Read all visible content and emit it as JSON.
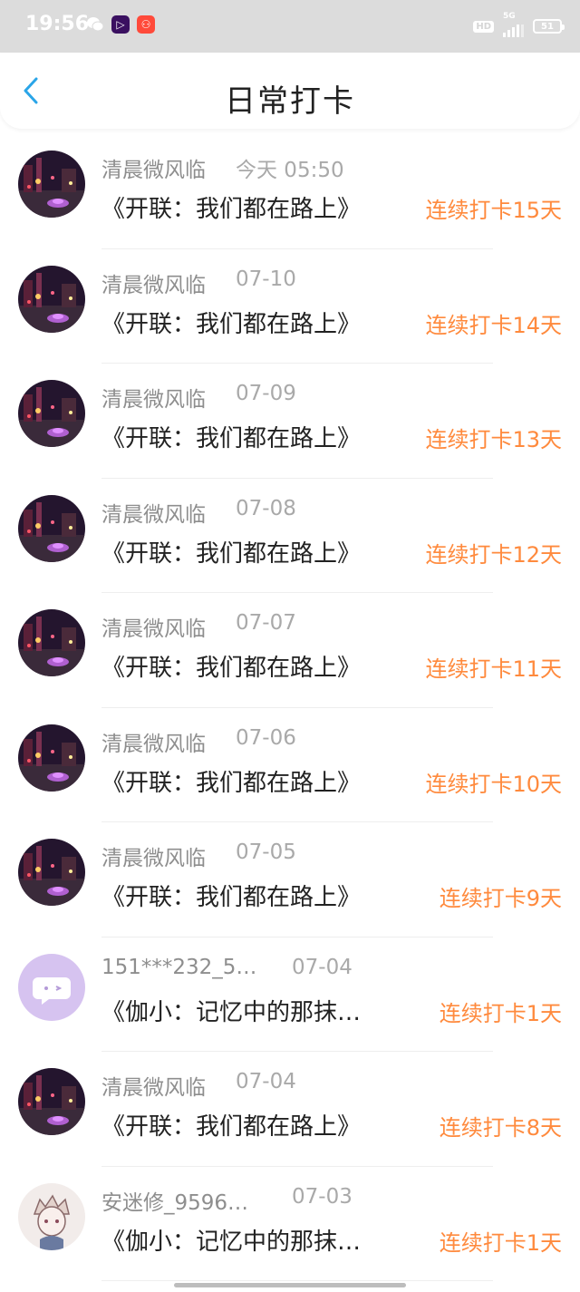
{
  "status_bar": {
    "time": "19:56",
    "network": "5G",
    "hd": "HD",
    "battery": "51"
  },
  "header": {
    "title": "日常打卡"
  },
  "colors": {
    "accent_back": "#2aa5e8",
    "streak": "#ff8a3d"
  },
  "records": [
    {
      "name": "清晨微风临",
      "time": "今天 05:50",
      "book": "《开联：我们都在路上》",
      "streak": "连续打卡15天",
      "avatar": "night-street-avatar"
    },
    {
      "name": "清晨微风临",
      "time": "07-10",
      "book": "《开联：我们都在路上》",
      "streak": "连续打卡14天",
      "avatar": "night-street-avatar"
    },
    {
      "name": "清晨微风临",
      "time": "07-09",
      "book": "《开联：我们都在路上》",
      "streak": "连续打卡13天",
      "avatar": "night-street-avatar"
    },
    {
      "name": "清晨微风临",
      "time": "07-08",
      "book": "《开联：我们都在路上》",
      "streak": "连续打卡12天",
      "avatar": "night-street-avatar"
    },
    {
      "name": "清晨微风临",
      "time": "07-07",
      "book": "《开联：我们都在路上》",
      "streak": "连续打卡11天",
      "avatar": "night-street-avatar"
    },
    {
      "name": "清晨微风临",
      "time": "07-06",
      "book": "《开联：我们都在路上》",
      "streak": "连续打卡10天",
      "avatar": "night-street-avatar"
    },
    {
      "name": "清晨微风临",
      "time": "07-05",
      "book": "《开联：我们都在路上》",
      "streak": "连续打卡9天",
      "avatar": "night-street-avatar"
    },
    {
      "name": "151***232_5…",
      "time": "07-04",
      "book": "《伽小：记忆中的那抹…",
      "streak": "连续打卡1天",
      "avatar": "purple-chat-avatar"
    },
    {
      "name": "清晨微风临",
      "time": "07-04",
      "book": "《开联：我们都在路上》",
      "streak": "连续打卡8天",
      "avatar": "night-street-avatar"
    },
    {
      "name": "安迷修_9596…",
      "time": "07-03",
      "book": "《伽小：记忆中的那抹…",
      "streak": "连续打卡1天",
      "avatar": "anime-sketch-avatar"
    }
  ]
}
